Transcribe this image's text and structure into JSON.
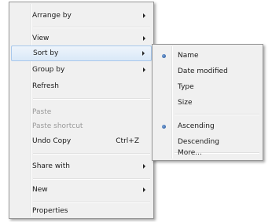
{
  "main_menu": {
    "items": [
      {
        "label": "Arrange by",
        "submenu": true,
        "disabled": false
      },
      {
        "label": "View",
        "submenu": true,
        "disabled": false
      },
      {
        "label": "Sort by",
        "submenu": true,
        "disabled": false,
        "highlighted": true
      },
      {
        "label": "Group by",
        "submenu": true,
        "disabled": false
      },
      {
        "label": "Refresh",
        "submenu": false,
        "disabled": false
      },
      {
        "label": "Paste",
        "submenu": false,
        "disabled": true
      },
      {
        "label": "Paste shortcut",
        "submenu": false,
        "disabled": true
      },
      {
        "label": "Undo Copy",
        "shortcut": "Ctrl+Z",
        "submenu": false,
        "disabled": false
      },
      {
        "label": "Share with",
        "submenu": true,
        "disabled": false
      },
      {
        "label": "New",
        "submenu": true,
        "disabled": false
      },
      {
        "label": "Properties",
        "submenu": false,
        "disabled": false
      }
    ]
  },
  "sort_submenu": {
    "items": [
      {
        "label": "Name",
        "selected": true
      },
      {
        "label": "Date modified",
        "selected": false
      },
      {
        "label": "Type",
        "selected": false
      },
      {
        "label": "Size",
        "selected": false
      },
      {
        "label": "Ascending",
        "selected": true
      },
      {
        "label": "Descending",
        "selected": false
      },
      {
        "label": "More...",
        "selected": false
      }
    ]
  },
  "colors": {
    "menu_background": "#f0f0f0",
    "highlight": "#d9e8f8",
    "highlight_border": "#a8c8ec",
    "disabled_text": "#9a9a9a",
    "bullet": "#1e4f98"
  }
}
